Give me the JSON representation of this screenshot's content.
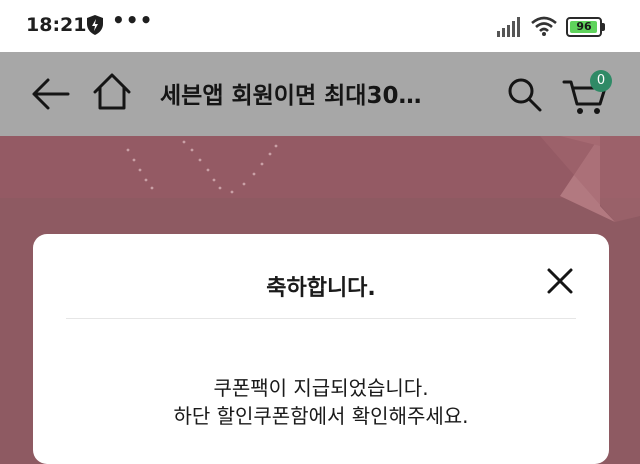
{
  "status_bar": {
    "time": "18:21",
    "more_indicator": "•••",
    "battery_level": "96",
    "icons": [
      "shield-bolt-icon",
      "cellular-signal-icon",
      "wifi-icon",
      "battery-icon"
    ]
  },
  "toolbar": {
    "title": "세븐앱 회원이면 최대30…",
    "cart_count": "0",
    "icons": [
      "back-arrow-icon",
      "home-icon",
      "search-icon",
      "cart-icon"
    ]
  },
  "modal": {
    "title": "축하합니다.",
    "message_line1": "쿠폰팩이 지급되었습니다.",
    "message_line2": "하단 할인쿠폰함에서 확인해주세요.",
    "close_icon": "close-icon"
  },
  "colors": {
    "overlay_background": "#8e5a62",
    "toolbar_background": "#a7a7a7",
    "cart_badge": "#2f8a66",
    "battery_fill": "#5fd35c"
  }
}
